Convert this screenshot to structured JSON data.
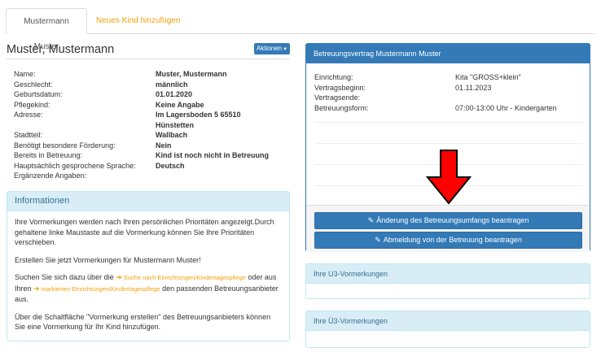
{
  "tabs": {
    "active": "Mustermann Muster",
    "add_child": "Neues Kind hinzufügen"
  },
  "person": {
    "name": "Muster, Mustermann",
    "actions_label": "Aktionen",
    "details": [
      {
        "label": "Name:",
        "value": "Muster, Mustermann"
      },
      {
        "label": "Geschlecht:",
        "value": "männlich"
      },
      {
        "label": "Geburtsdatum:",
        "value": "01.01.2020"
      },
      {
        "label": "Pflegekind:",
        "value": "Keine Angabe"
      },
      {
        "label": "Adresse:",
        "value": "Im Lagersboden 5 65510"
      },
      {
        "label": "",
        "value": "Hünstetten"
      },
      {
        "label": "Stadtteil:",
        "value": "Wallbach"
      },
      {
        "label": "Benötigt besondere Förderung:",
        "value": "Nein"
      },
      {
        "label": "Bereits in Betreuung:",
        "value": "Kind ist noch nicht in Betreuung"
      },
      {
        "label": "Hauptsächlich gesprochene Sprache:",
        "value": "Deutsch"
      },
      {
        "label": "Ergänzende Angaben:",
        "value": ""
      }
    ]
  },
  "info": {
    "title": "Informationen",
    "p1": "Ihre Vormerkungen werden nach Ihren persönlichen Prioritäten angezeigt.Durch gehaltene linke Maustaste auf die Vormerkung können Sie Ihre Prioritäten verschieben.",
    "p2": "Erstellen Sie jetzt Vormerkungen für Mustermann Muster!",
    "p3_pre": "Suchen Sie sich dazu über die",
    "p3_link1": "Suche nach Einrichtungen/Kindertagespflege",
    "p3_mid": "oder aus Ihren",
    "p3_link2": "markierten Einrichtungen/Kindertagespflege",
    "p3_post": "den passenden Betreuungsanbieter aus.",
    "p4": "Über die Schaltfläche \"Vormerkung erstellen\" des Betreuungsanbieters können Sie eine Vormerkung für Ihr Kind hinzufügen."
  },
  "contract": {
    "title": "Betreuungsvertrag Mustermann Muster",
    "rows": [
      {
        "label": "Einrichtung:",
        "value": "Kita \"GROSS+klein\""
      },
      {
        "label": "Vertragsbeginn:",
        "value": "01.11.2023"
      },
      {
        "label": "Vertragsende:",
        "value": ""
      },
      {
        "label": "Betreuungsform:",
        "value": "07:00-13:00 Uhr - Kindergarten"
      }
    ],
    "btn_change": "Änderung des Betreuungsumfangs beantragen",
    "btn_cancel": "Abmeldung von der Betreuung beantragen"
  },
  "u3": {
    "title": "Ihre U3-Vormerkungen"
  },
  "ue3": {
    "title": "Ihre Ü3-Vormerkungen"
  },
  "colors": {
    "primary": "#337ab7",
    "info_bg": "#d9edf7",
    "info_text": "#31708f",
    "link": "#f0a30a",
    "arrow": "#ff0000"
  },
  "icons": {
    "edit": "pencil-icon",
    "link_arrow": "arrow-right-icon",
    "caret": "caret-down-icon",
    "annotation": "red-arrow-down-icon"
  }
}
